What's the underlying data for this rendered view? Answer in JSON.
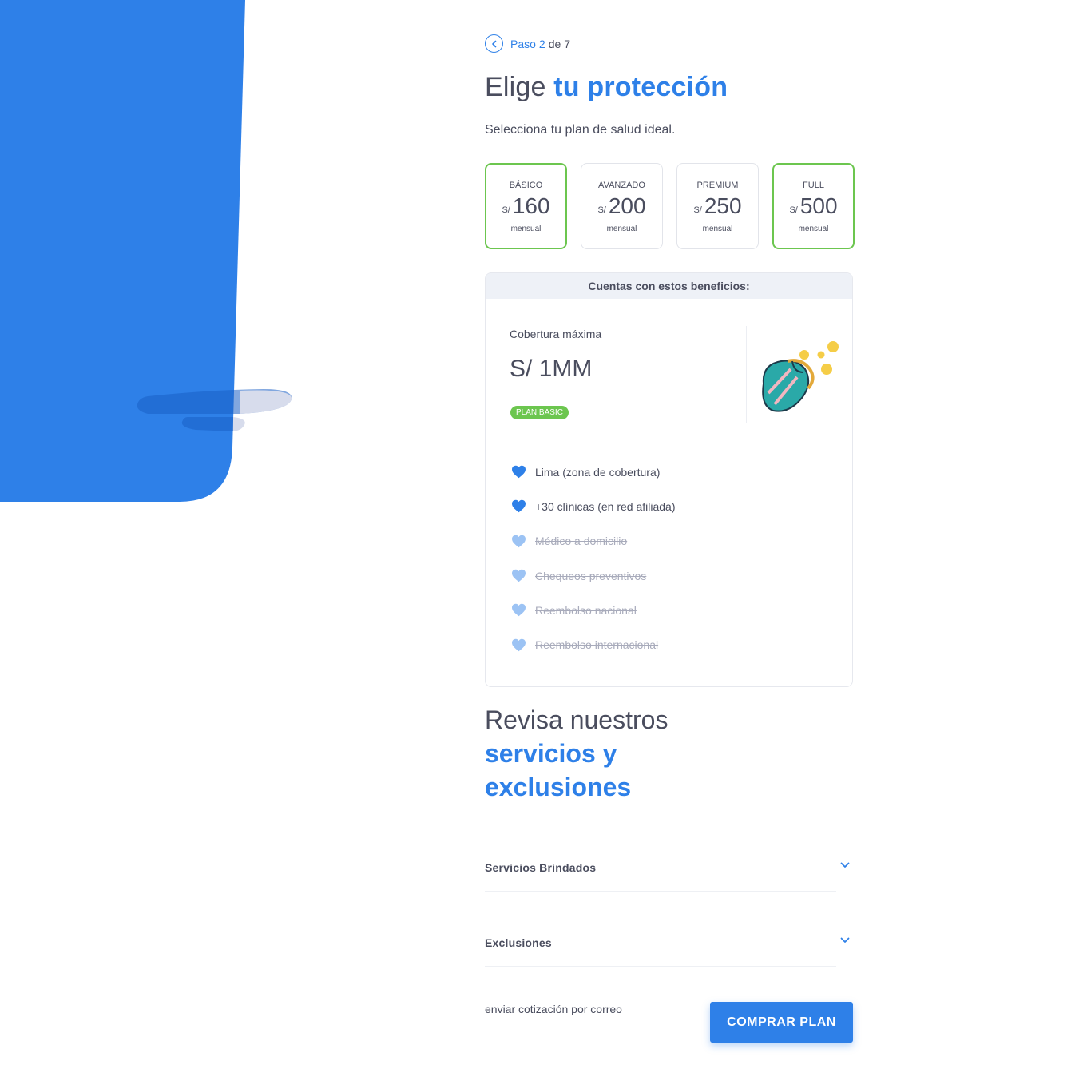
{
  "step": {
    "word": "Paso",
    "current": "2",
    "of": "de",
    "total": "7"
  },
  "title": {
    "lead": "Elige",
    "highlight": "tu protección"
  },
  "subtitle": "Selecciona tu plan de salud ideal.",
  "plans": [
    {
      "name": "BÁSICO",
      "currency": "S/",
      "amount": "160",
      "period": "mensual",
      "selected": true
    },
    {
      "name": "AVANZADO",
      "currency": "S/",
      "amount": "200",
      "period": "mensual",
      "selected": false
    },
    {
      "name": "PREMIUM",
      "currency": "S/",
      "amount": "250",
      "period": "mensual",
      "selected": false
    },
    {
      "name": "FULL",
      "currency": "S/",
      "amount": "500",
      "period": "mensual",
      "selected": true
    }
  ],
  "benefits": {
    "header": "Cuentas con estos beneficios:",
    "coverage_label": "Cobertura máxima",
    "coverage_value": "S/ 1MM",
    "badge": "PLAN BASIC",
    "items": [
      {
        "label": "Lima (zona de cobertura)",
        "active": true
      },
      {
        "label": "+30 clínicas (en red afiliada)",
        "active": true
      },
      {
        "label": "Médico a domicilio",
        "active": false
      },
      {
        "label": "Chequeos preventivos",
        "active": false
      },
      {
        "label": "Reembolso nacional",
        "active": false
      },
      {
        "label": "Reembolso internacional",
        "active": false
      }
    ]
  },
  "review": {
    "lead": "Revisa nuestros",
    "highlight1": "servicios y",
    "highlight2": "exclusiones"
  },
  "accordions": [
    {
      "label": "Servicios Brindados"
    },
    {
      "label": "Exclusiones"
    }
  ],
  "footer": {
    "mail_link": "enviar cotización por correo",
    "buy_button": "COMPRAR PLAN"
  },
  "colors": {
    "primary": "#2e80e8",
    "selected_border": "#6cc64f",
    "text": "#4a4d5e",
    "muted": "#a8abbb"
  },
  "icons": {
    "back": "chevron-left-icon",
    "heart": "heart-icon",
    "accordion": "chevron-down-icon",
    "illustration": "coin-purse-illustration"
  }
}
